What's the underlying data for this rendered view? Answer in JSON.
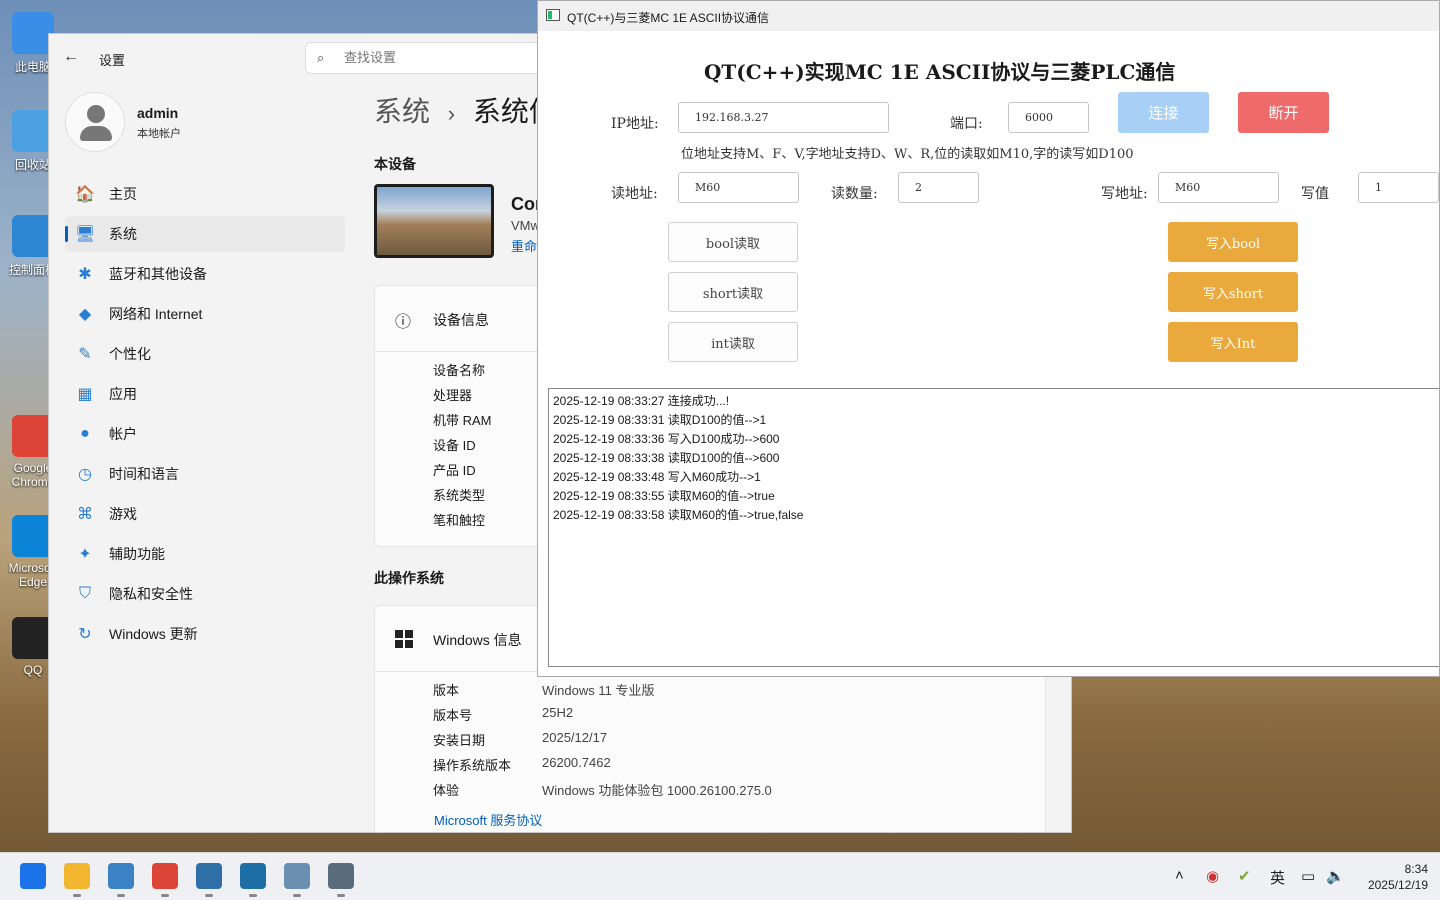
{
  "desktop": {
    "icons": [
      {
        "label": "此电脑",
        "icon": "computer-icon",
        "color": "#3a8ee6"
      },
      {
        "label": "回收站",
        "icon": "recycle-bin-icon",
        "color": "#4aa0e0"
      },
      {
        "label": "控制面板",
        "icon": "control-panel-icon",
        "color": "#2c86d2"
      },
      {
        "label": "Google Chrome",
        "icon": "chrome-icon",
        "color": "#db4437"
      },
      {
        "label": "Microsoft Edge",
        "icon": "edge-icon",
        "color": "#0c84d8"
      },
      {
        "label": "QQ",
        "icon": "qq-icon",
        "color": "#222222"
      }
    ]
  },
  "settings": {
    "app_title": "设置",
    "search_placeholder": "查找设置",
    "user": {
      "name": "admin",
      "type": "本地帐户"
    },
    "nav": [
      {
        "label": "主页",
        "icon": "home-icon",
        "glyph": "🏠"
      },
      {
        "label": "系统",
        "icon": "system-icon",
        "glyph": "🖥"
      },
      {
        "label": "蓝牙和其他设备",
        "icon": "bluetooth-icon",
        "glyph": "✱"
      },
      {
        "label": "网络和 Internet",
        "icon": "wifi-icon",
        "glyph": "◆"
      },
      {
        "label": "个性化",
        "icon": "brush-icon",
        "glyph": "✎"
      },
      {
        "label": "应用",
        "icon": "apps-icon",
        "glyph": "▦"
      },
      {
        "label": "帐户",
        "icon": "account-icon",
        "glyph": "●"
      },
      {
        "label": "时间和语言",
        "icon": "clock-globe-icon",
        "glyph": "◷"
      },
      {
        "label": "游戏",
        "icon": "gamepad-icon",
        "glyph": "⌘"
      },
      {
        "label": "辅助功能",
        "icon": "accessibility-icon",
        "glyph": "✦"
      },
      {
        "label": "隐私和安全性",
        "icon": "shield-icon",
        "glyph": "⛉"
      },
      {
        "label": "Windows 更新",
        "icon": "update-icon",
        "glyph": "↻"
      }
    ],
    "active_nav": "系统",
    "breadcrumb": {
      "parent": "系统",
      "separator": "›",
      "current": "系统信"
    },
    "this_device_heading": "本设备",
    "device": {
      "name": "Cor",
      "sub": "VMw",
      "rename_link": "重命"
    },
    "device_info": {
      "title": "设备信息",
      "keys": [
        "设备名称",
        "处理器",
        "机带 RAM",
        "设备 ID",
        "产品 ID",
        "系统类型",
        "笔和触控"
      ]
    },
    "os_heading": "此操作系统",
    "windows_info": {
      "title": "Windows 信息",
      "rows": [
        {
          "k": "版本",
          "v": "Windows 11 专业版"
        },
        {
          "k": "版本号",
          "v": "25H2"
        },
        {
          "k": "安装日期",
          "v": "2025/12/17"
        },
        {
          "k": "操作系统版本",
          "v": "26200.7462"
        },
        {
          "k": "体验",
          "v": "Windows 功能体验包 1000.26100.275.0"
        }
      ],
      "link": "Microsoft 服务协议"
    }
  },
  "qt": {
    "window_title": "QT(C++)与三菱MC 1E ASCII协议通信",
    "heading": "QT(C++)实现MC 1E ASCII协议与三菱PLC通信",
    "ip_label": "IP地址:",
    "ip_value": "192.168.3.27",
    "port_label": "端口:",
    "port_value": "6000",
    "connect_label": "连接",
    "disconnect_label": "断开",
    "hint": "位地址支持M、F、V,字地址支持D、W、R,位的读取如M10,字的读写如D100",
    "read_addr_label": "读地址:",
    "read_addr_value": "M60",
    "read_count_label": "读数量:",
    "read_count_value": "2",
    "write_addr_label": "写地址:",
    "write_addr_value": "M60",
    "write_value_label": "写值",
    "write_value_value": "1",
    "read_buttons": [
      "bool读取",
      "short读取",
      "int读取"
    ],
    "write_buttons": [
      "写入bool",
      "写入short",
      "写入Int"
    ],
    "log": [
      "2025-12-19 08:33:27 连接成功...!",
      "2025-12-19 08:33:31 读取D100的值-->1",
      "2025-12-19 08:33:36 写入D100成功-->600",
      "2025-12-19 08:33:38 读取D100的值-->600",
      "2025-12-19 08:33:48 写入M60成功-->1",
      "2025-12-19 08:33:55 读取M60的值-->true",
      "2025-12-19 08:33:58 读取M60的值-->true,false"
    ],
    "colors": {
      "connect": "#a8cff5",
      "disconnect": "#ef6b6b",
      "write": "#e9a93c"
    }
  },
  "taskbar": {
    "apps": [
      {
        "icon": "start-icon",
        "running": false
      },
      {
        "icon": "file-explorer-icon",
        "running": true
      },
      {
        "icon": "app-window-icon",
        "running": true
      },
      {
        "icon": "chrome-icon",
        "running": true
      },
      {
        "icon": "desktop-app-icon",
        "running": true
      },
      {
        "icon": "vs-icon",
        "running": true
      },
      {
        "icon": "qt-app-icon",
        "running": true
      },
      {
        "icon": "settings-gear-icon",
        "running": true
      }
    ],
    "ime": "英",
    "time": "8:34",
    "date": "2025/12/19"
  }
}
